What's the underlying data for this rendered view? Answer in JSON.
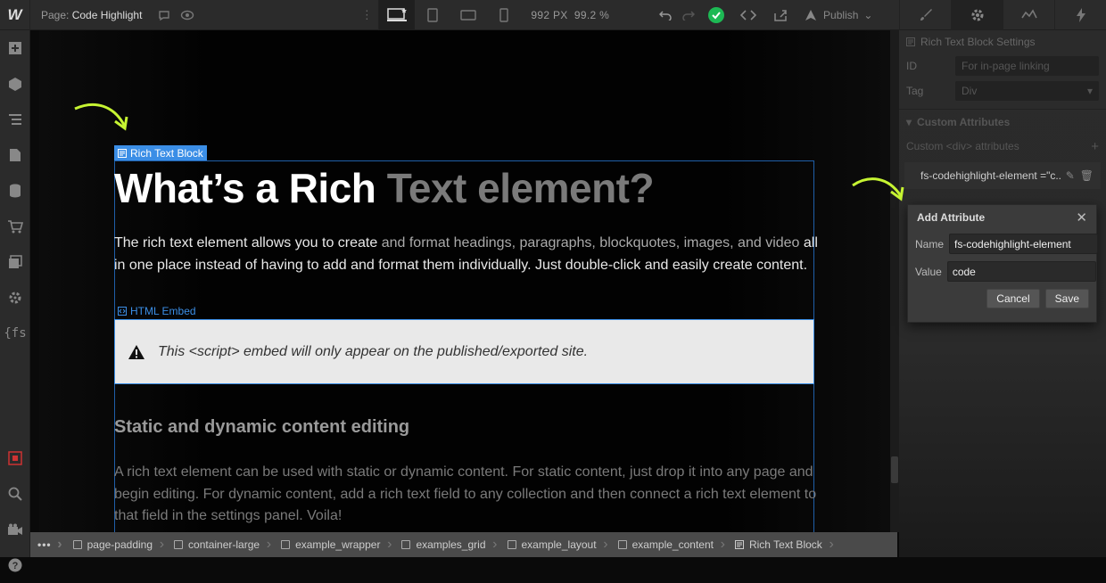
{
  "topbar": {
    "logo": "W",
    "page_prefix": "Page:",
    "page_name": "Code Highlight",
    "px_readout": "992 PX",
    "zoom": "99.2 %",
    "publish_label": "Publish"
  },
  "canvas": {
    "selected_tag": "Rich Text Block",
    "heading_bright": "What’s a Rich ",
    "heading_dim": "Text element?",
    "para_bright": "The rich text element allows you to create ",
    "para_fade": "and format headings, paragraphs, blockquotes, images, and video",
    "para_rest": " all in one place instead of having to add and format them individually. Just double-click and easily create content.",
    "embed_tag": "HTML Embed",
    "embed_notice": "This <script> embed will only appear on the published/exported site.",
    "subheading": "Static and dynamic content editing",
    "para2": "A rich text element can be used with static or dynamic content. For static content, just drop it into any page and begin editing. For dynamic content, add a rich text field to any collection and then connect a rich text element to that field in the settings panel. Voila!"
  },
  "panel": {
    "title": "Rich Text Block Settings",
    "id_label": "ID",
    "id_placeholder": "For in-page linking",
    "tag_label": "Tag",
    "tag_value": "Div",
    "custom_attrs_header": "Custom Attributes",
    "custom_attrs_sub": "Custom <div> attributes",
    "attr_item": "fs-codehighlight-element =\"c..."
  },
  "dialog": {
    "title": "Add Attribute",
    "name_label": "Name",
    "name_value": "fs-codehighlight-element",
    "value_label": "Value",
    "value_value": "code",
    "cancel": "Cancel",
    "save": "Save"
  },
  "breadcrumbs": [
    "page-padding",
    "container-large",
    "example_wrapper",
    "examples_grid",
    "example_layout",
    "example_content",
    "Rich Text Block"
  ],
  "colors": {
    "accent_blue": "#3b8ee6",
    "arrow_green": "#c6f432",
    "check_green": "#1db954"
  }
}
